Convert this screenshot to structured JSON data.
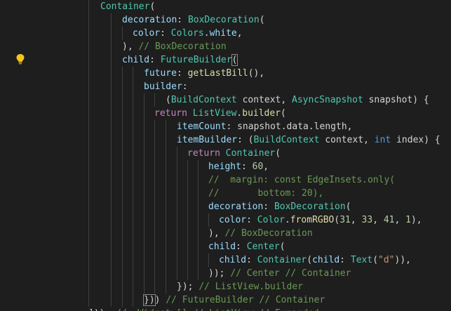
{
  "editor": {
    "colors": {
      "background": "#1e1e1e",
      "function": "#dcdcaa",
      "class": "#4ec9b0",
      "property": "#9cdcfe",
      "keyword_control": "#c586c0",
      "keyword": "#569cd6",
      "comment": "#6a9955",
      "number": "#b5cea8",
      "string": "#ce9178",
      "text": "#d4d4d4"
    },
    "gutter_icon": "lightbulb-icon",
    "lines": [
      {
        "tokens": [
          {
            "t": "Container",
            "c": "cls"
          },
          {
            "t": "(",
            "c": "punct"
          }
        ]
      },
      {
        "tokens": [
          {
            "t": "decoration",
            "c": "prop"
          },
          {
            "t": ": ",
            "c": "punct"
          },
          {
            "t": "BoxDecoration",
            "c": "cls"
          },
          {
            "t": "(",
            "c": "punct"
          }
        ]
      },
      {
        "tokens": [
          {
            "t": "color",
            "c": "prop"
          },
          {
            "t": ": ",
            "c": "punct"
          },
          {
            "t": "Colors",
            "c": "cls"
          },
          {
            "t": ".",
            "c": "punct"
          },
          {
            "t": "white",
            "c": "prop"
          },
          {
            "t": ",",
            "c": "punct"
          }
        ]
      },
      {
        "tokens": [
          {
            "t": "), ",
            "c": "punct"
          },
          {
            "t": "// BoxDecoration",
            "c": "cmt"
          }
        ]
      },
      {
        "tokens": [
          {
            "t": "child",
            "c": "prop"
          },
          {
            "t": ": ",
            "c": "punct"
          },
          {
            "t": "FutureBuilder",
            "c": "cls"
          },
          {
            "t": "(",
            "c": "bracket"
          }
        ]
      },
      {
        "tokens": [
          {
            "t": "future",
            "c": "prop"
          },
          {
            "t": ": ",
            "c": "punct"
          },
          {
            "t": "getLastBill",
            "c": "fn"
          },
          {
            "t": "(),",
            "c": "punct"
          }
        ]
      },
      {
        "tokens": [
          {
            "t": "builder",
            "c": "prop"
          },
          {
            "t": ":",
            "c": "punct"
          }
        ]
      },
      {
        "tokens": [
          {
            "t": "(",
            "c": "punct"
          },
          {
            "t": "BuildContext",
            "c": "cls"
          },
          {
            "t": " context, ",
            "c": "plain"
          },
          {
            "t": "AsyncSnapshot",
            "c": "cls"
          },
          {
            "t": " snapshot) {",
            "c": "plain"
          }
        ]
      },
      {
        "tokens": [
          {
            "t": "return ",
            "c": "kw"
          },
          {
            "t": "ListView",
            "c": "cls"
          },
          {
            "t": ".",
            "c": "punct"
          },
          {
            "t": "builder",
            "c": "fn"
          },
          {
            "t": "(",
            "c": "punct"
          }
        ]
      },
      {
        "tokens": [
          {
            "t": "itemCount",
            "c": "prop"
          },
          {
            "t": ": snapshot.data.length,",
            "c": "plain"
          }
        ]
      },
      {
        "tokens": [
          {
            "t": "itemBuilder",
            "c": "prop"
          },
          {
            "t": ": (",
            "c": "punct"
          },
          {
            "t": "BuildContext",
            "c": "cls"
          },
          {
            "t": " context, ",
            "c": "plain"
          },
          {
            "t": "int",
            "c": "kwb"
          },
          {
            "t": " index) {",
            "c": "plain"
          }
        ]
      },
      {
        "tokens": [
          {
            "t": "return ",
            "c": "kw"
          },
          {
            "t": "Container",
            "c": "cls"
          },
          {
            "t": "(",
            "c": "punct"
          }
        ]
      },
      {
        "tokens": [
          {
            "t": "height",
            "c": "prop"
          },
          {
            "t": ": ",
            "c": "punct"
          },
          {
            "t": "60",
            "c": "num"
          },
          {
            "t": ",",
            "c": "punct"
          }
        ]
      },
      {
        "tokens": [
          {
            "t": "//  margin: const EdgeInsets.only(",
            "c": "cmt"
          }
        ]
      },
      {
        "tokens": [
          {
            "t": "//       bottom: 20),",
            "c": "cmt"
          }
        ]
      },
      {
        "tokens": [
          {
            "t": "decoration",
            "c": "prop"
          },
          {
            "t": ": ",
            "c": "punct"
          },
          {
            "t": "BoxDecoration",
            "c": "cls"
          },
          {
            "t": "(",
            "c": "punct"
          }
        ]
      },
      {
        "tokens": [
          {
            "t": "color",
            "c": "prop"
          },
          {
            "t": ": ",
            "c": "punct"
          },
          {
            "t": "Color",
            "c": "cls"
          },
          {
            "t": ".",
            "c": "punct"
          },
          {
            "t": "fromRGBO",
            "c": "fn"
          },
          {
            "t": "(",
            "c": "punct"
          },
          {
            "t": "31",
            "c": "num"
          },
          {
            "t": ", ",
            "c": "punct"
          },
          {
            "t": "33",
            "c": "num"
          },
          {
            "t": ", ",
            "c": "punct"
          },
          {
            "t": "41",
            "c": "num"
          },
          {
            "t": ", ",
            "c": "punct"
          },
          {
            "t": "1",
            "c": "num"
          },
          {
            "t": "),",
            "c": "punct"
          }
        ]
      },
      {
        "tokens": [
          {
            "t": "), ",
            "c": "punct"
          },
          {
            "t": "// BoxDecoration",
            "c": "cmt"
          }
        ]
      },
      {
        "tokens": [
          {
            "t": "child",
            "c": "prop"
          },
          {
            "t": ": ",
            "c": "punct"
          },
          {
            "t": "Center",
            "c": "cls"
          },
          {
            "t": "(",
            "c": "punct"
          }
        ]
      },
      {
        "tokens": [
          {
            "t": "child",
            "c": "prop"
          },
          {
            "t": ": ",
            "c": "punct"
          },
          {
            "t": "Container",
            "c": "cls"
          },
          {
            "t": "(",
            "c": "punct"
          },
          {
            "t": "child",
            "c": "prop"
          },
          {
            "t": ": ",
            "c": "punct"
          },
          {
            "t": "Text",
            "c": "cls"
          },
          {
            "t": "(",
            "c": "punct"
          },
          {
            "t": "\"d\"",
            "c": "str"
          },
          {
            "t": ")),",
            "c": "punct"
          }
        ]
      },
      {
        "tokens": [
          {
            "t": ")); ",
            "c": "punct"
          },
          {
            "t": "// Center // Container",
            "c": "cmt"
          }
        ]
      },
      {
        "tokens": [
          {
            "t": "}); ",
            "c": "punct"
          },
          {
            "t": "// ListView.builder",
            "c": "cmt"
          }
        ]
      },
      {
        "tokens": [
          {
            "t": "})",
            "c": "bracket"
          },
          {
            "t": ") ",
            "c": "punct"
          },
          {
            "t": "// FutureBuilder // Container",
            "c": "cmt"
          }
        ]
      },
      {
        "tokens": [
          {
            "t": "])); ",
            "c": "punct"
          },
          {
            "t": "// <Widget>[] // ListView // Expanded",
            "c": "cmt"
          }
        ]
      }
    ]
  }
}
